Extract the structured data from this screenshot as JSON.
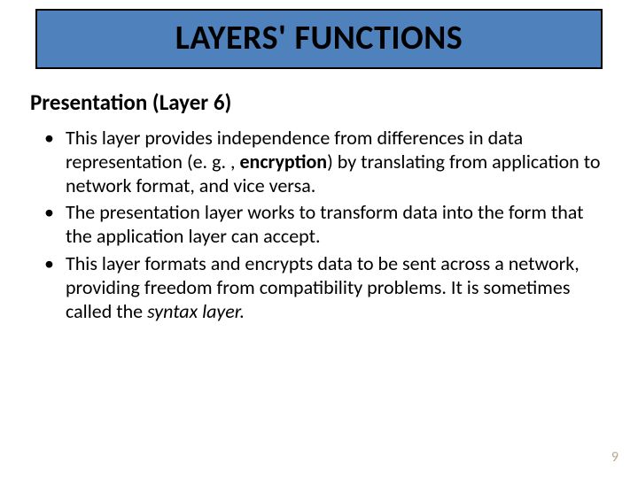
{
  "title": "LAYERS' FUNCTIONS",
  "subtitle": "Presentation (Layer 6)",
  "bullets": [
    {
      "pre": " This layer provides independence from differences in data representation (e. g. , ",
      "bold": "encryption",
      "post": ") by translating from application to network format, and vice versa."
    },
    {
      "pre": "The presentation layer works to transform data into the form that the application layer can accept.",
      "bold": "",
      "post": ""
    },
    {
      "pre": "This layer formats and encrypts data to be sent across a network, providing freedom from compatibility problems. It is sometimes called the ",
      "italic": "syntax layer.",
      "post": ""
    }
  ],
  "page_number": "9"
}
